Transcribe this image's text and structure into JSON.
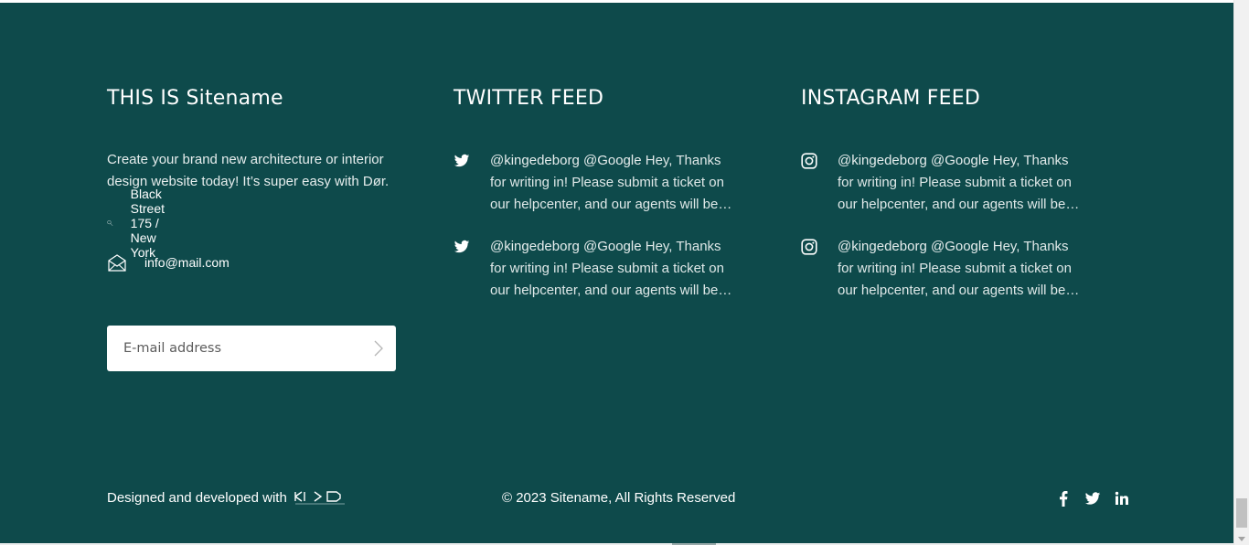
{
  "about": {
    "title": "THIS IS Sitename",
    "description": "Create your brand new architecture or interior design website today! It’s super easy with Dør.",
    "address": "Black Street 175 / New York",
    "email": "info@mail.com",
    "newsletter_placeholder": "E-mail address"
  },
  "twitter": {
    "title": "TWITTER FEED",
    "items": [
      {
        "handle": "@kingedeborg @Google",
        "text": " Hey, Thanks for writing in! Please submit a ticket on our helpcenter, and our agents will be…"
      },
      {
        "handle": "@kingedeborg @Google",
        "text": " Hey, Thanks for writing in! Please submit a ticket on our helpcenter, and our agents will be…"
      }
    ]
  },
  "instagram": {
    "title": "INSTAGRAM FEED",
    "items": [
      {
        "handle": "@kingedeborg @Google",
        "text": " Hey, Thanks for writing in! Please submit a ticket on our helpcenter, and our agents will be…"
      },
      {
        "handle": "@kingedeborg @Google",
        "text": " Hey, Thanks for writing in! Please submit a ticket on our helpcenter, and our agents will be…"
      }
    ]
  },
  "bottom": {
    "designed_by": "Designed and developed with",
    "copyright": "© 2023 Sitename, All Rights Reserved",
    "socials": [
      "facebook-icon",
      "twitter-icon",
      "linkedin-icon"
    ]
  },
  "colors": {
    "footer_bg": "#0e4a4b",
    "text": "#ffffff"
  }
}
